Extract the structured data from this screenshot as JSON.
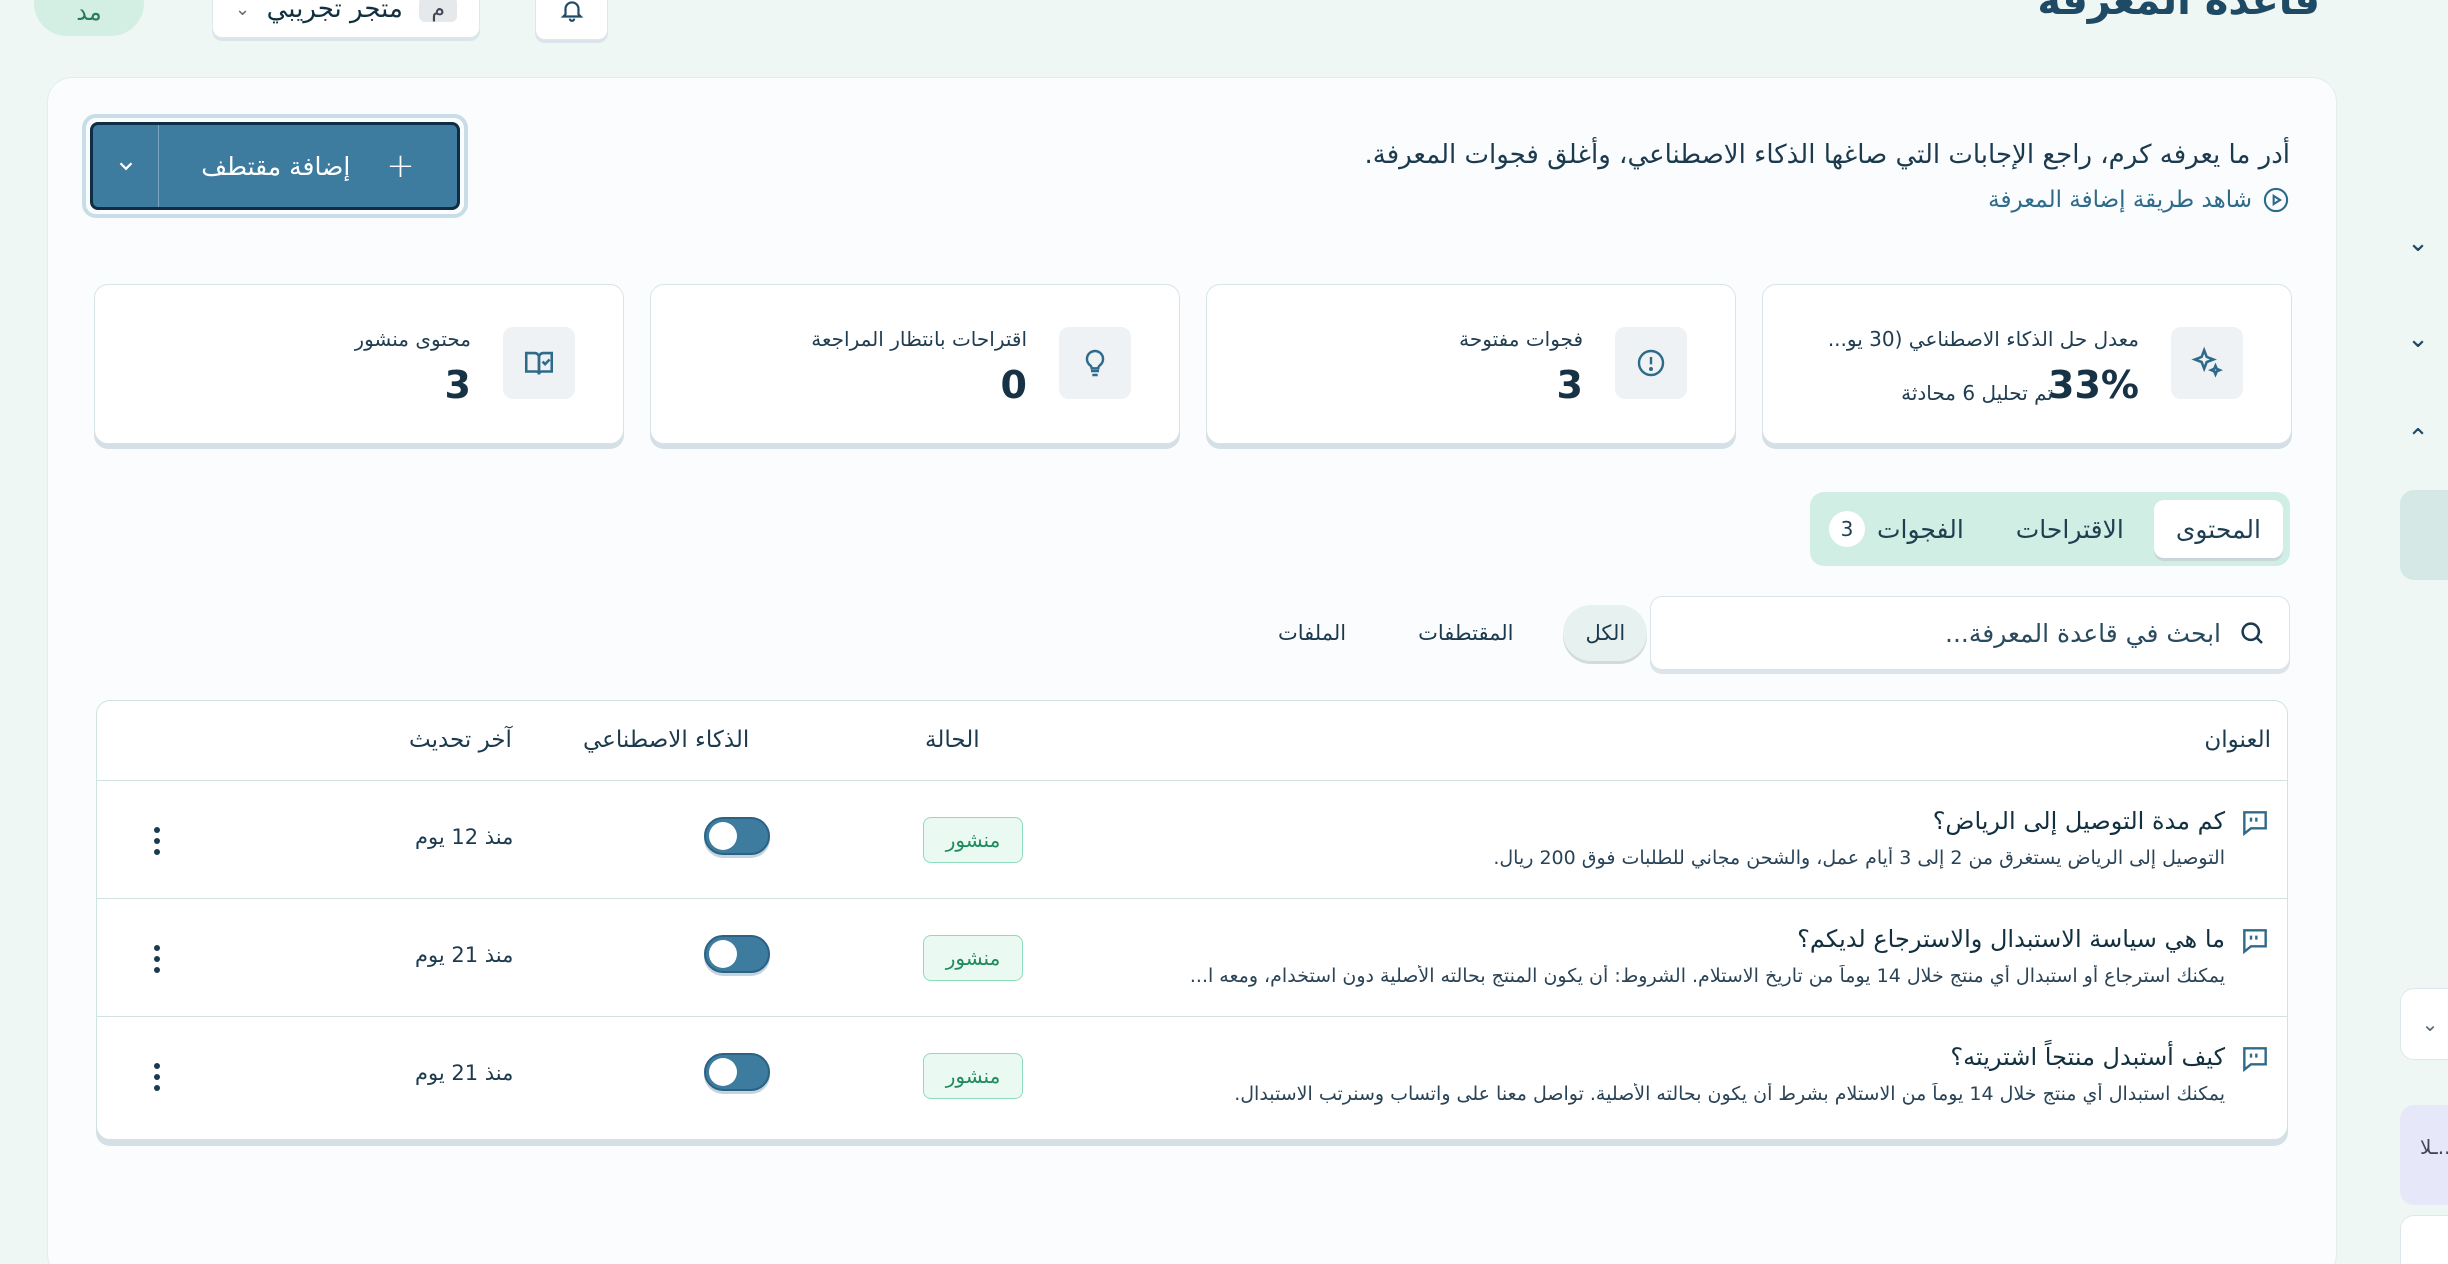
{
  "header": {
    "title": "قاعدة المعرفة",
    "avatar_initials": "مد",
    "store": {
      "badge": "م",
      "name": "متجر تجريبي"
    }
  },
  "intro": {
    "description": "أدر ما يعرفه كرم، راجع الإجابات التي صاغها الذكاء الاصطناعي، وأغلق فجوات المعرفة.",
    "video_link": "شاهد طريقة إضافة المعرفة"
  },
  "add_button": {
    "label": "إضافة مقتطف"
  },
  "stats": {
    "ai_rate": {
      "label": "معدل حل الذكاء الاصطناعي (30 يو...",
      "value": "33%",
      "sub": "تم تحليل 6 محادثة"
    },
    "open_gaps": {
      "label": "فجوات مفتوحة",
      "value": "3"
    },
    "pending": {
      "label": "اقتراحات بانتظار المراجعة",
      "value": "0"
    },
    "published": {
      "label": "محتوى منشور",
      "value": "3"
    }
  },
  "tabs": {
    "content": "المحتوى",
    "suggestions": "الاقتراحات",
    "gaps": "الفجوات",
    "gaps_count": "3"
  },
  "search": {
    "placeholder": "ابحث في قاعدة المعرفة..."
  },
  "filters": {
    "all": "الكل",
    "snippets": "المقتطفات",
    "files": "الملفات"
  },
  "table": {
    "columns": {
      "title": "العنوان",
      "status": "الحالة",
      "ai": "الذكاء الاصطناعي",
      "updated": "آخر تحديث"
    },
    "rows": [
      {
        "title": "كم مدة التوصيل إلى الرياض؟",
        "snippet": "التوصيل إلى الرياض يستغرق من 2 إلى 3 أيام عمل، والشحن مجاني للطلبات فوق 200 ريال.",
        "status": "منشور",
        "ai_enabled": true,
        "updated": "منذ 12 يوم"
      },
      {
        "title": "ما هي سياسة الاستبدال والاسترجاع لديكم؟",
        "snippet": "يمكنك استرجاع أو استبدال أي منتج خلال 14 يوماً من تاريخ الاستلام. الشروط: أن يكون المنتج بحالته الأصلية دون استخدام، ومعه ا...",
        "status": "منشور",
        "ai_enabled": true,
        "updated": "منذ 21 يوم"
      },
      {
        "title": "كيف أستبدل منتجاً اشتريته؟",
        "snippet": "يمكنك استبدال أي منتج خلال 14 يوماً من الاستلام بشرط أن يكون بحالته الأصلية. تواصل معنا على واتساب وسنرتب الاستبدال.",
        "status": "منشور",
        "ai_enabled": true,
        "updated": "منذ 21 يوم"
      }
    ]
  },
  "side_panel": {
    "snippet_text": "ـلا..."
  },
  "colors": {
    "accent": "#3d7c9f",
    "background": "#eef7f3",
    "published": "#208a5c"
  }
}
